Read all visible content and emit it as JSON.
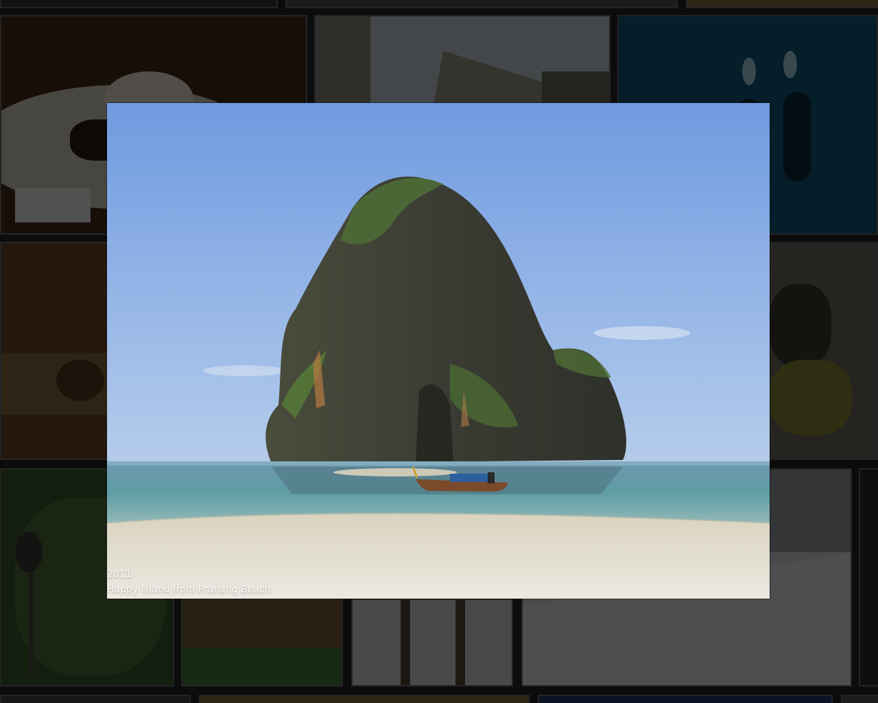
{
  "lightbox": {
    "year": "2011",
    "caption": "Happy Island from Pranang Beach"
  },
  "colors": {
    "sky_top": "#7aa3e6",
    "sky_bottom": "#c6d8ec",
    "sea": "#5a8fa0",
    "sand": "#e1dac9",
    "rock": "#3e4036",
    "foliage": "#4d6a34",
    "tile_border": "#6a6a6a"
  },
  "tiles": [
    {
      "subject": "dessert-plate"
    },
    {
      "subject": "stone-ruins"
    },
    {
      "subject": "scuba-divers"
    },
    {
      "subject": "painting"
    },
    {
      "subject": "monitor-lizard"
    },
    {
      "subject": "monkey-in-tree"
    },
    {
      "subject": "city-square"
    },
    {
      "subject": "ladder-snow"
    },
    {
      "subject": "snowy-mountain"
    }
  ]
}
